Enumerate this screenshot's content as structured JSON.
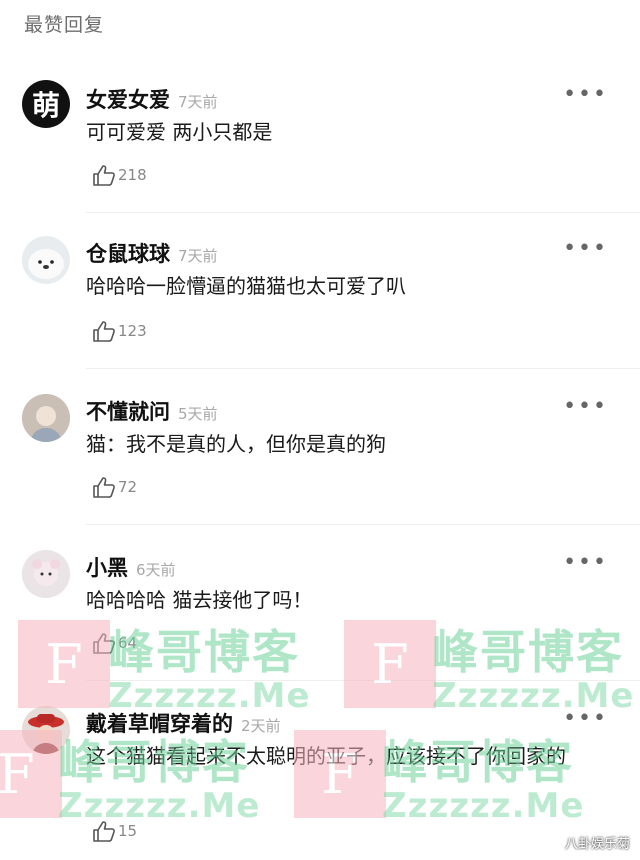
{
  "section": {
    "title": "最赞回复"
  },
  "more_glyph": "•••",
  "comments": [
    {
      "author": "女爱女爱",
      "time": "7天前",
      "text": "可可爱爱 两小只都是",
      "likes": "218",
      "avatar_char": "萌"
    },
    {
      "author": "仓鼠球球",
      "time": "7天前",
      "text": "哈哈哈一脸懵逼的猫猫也太可爱了叭",
      "likes": "123"
    },
    {
      "author": "不懂就问",
      "time": "5天前",
      "text": "猫：我不是真的人，但你是真的狗",
      "likes": "72"
    },
    {
      "author": "小黑",
      "time": "6天前",
      "text": "哈哈哈哈 猫去接他了吗！",
      "likes": "64"
    },
    {
      "author": "戴着草帽穿着的",
      "time": "2天前",
      "text": "这个猫猫看起来不太聪明的亚子，应该接不了你回家的",
      "likes": "15"
    }
  ],
  "watermark": {
    "logo": "F",
    "title": "峰哥博客",
    "url": "Zzzzzz.Me"
  },
  "corner_mark": "八卦娱乐菊",
  "colors": {
    "watermark_green": "#6fd39a",
    "watermark_pink": "#f7b6c0"
  }
}
